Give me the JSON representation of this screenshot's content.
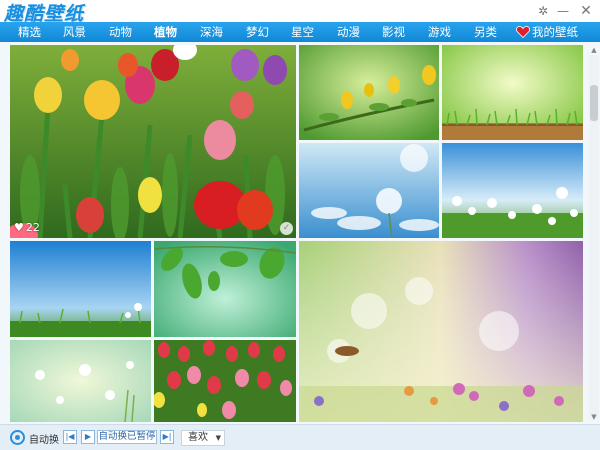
{
  "app": {
    "title": "趣酷壁纸"
  },
  "window": {
    "settings_icon": "gear-icon",
    "minimize_label": "—",
    "close_label": "✕"
  },
  "nav": {
    "items": [
      {
        "label": "精选",
        "active": false
      },
      {
        "label": "风景",
        "active": false
      },
      {
        "label": "动物",
        "active": false
      },
      {
        "label": "植物",
        "active": true
      },
      {
        "label": "深海",
        "active": false
      },
      {
        "label": "梦幻",
        "active": false
      },
      {
        "label": "星空",
        "active": false
      },
      {
        "label": "动漫",
        "active": false
      },
      {
        "label": "影视",
        "active": false
      },
      {
        "label": "游戏",
        "active": false
      },
      {
        "label": "另类",
        "active": false
      }
    ],
    "mine_label": "我的壁纸",
    "mine_icon": "heart-icon"
  },
  "gallery": {
    "featured": {
      "likes": "22",
      "check_icon": "checkmark-icon"
    },
    "tiles": [
      {
        "subject": "tulips"
      },
      {
        "subject": "yellow buds on branch"
      },
      {
        "subject": "green grass on wood"
      },
      {
        "subject": "dandelion sky"
      },
      {
        "subject": "white flowers meadow"
      },
      {
        "subject": "blue sky grass"
      },
      {
        "subject": "green leaves"
      },
      {
        "subject": "pastel white flowers"
      },
      {
        "subject": "tulip field"
      },
      {
        "subject": "dreamy flower meadow"
      }
    ]
  },
  "bottom": {
    "auto_label": "自动换",
    "prev_icon": "prev-icon",
    "play_icon": "play-icon",
    "next_icon": "next-icon",
    "status": "自动换已暂停",
    "sort_value": "喜欢"
  },
  "colors": {
    "nav": "#1a94e0",
    "accent": "#1a8fe0"
  }
}
